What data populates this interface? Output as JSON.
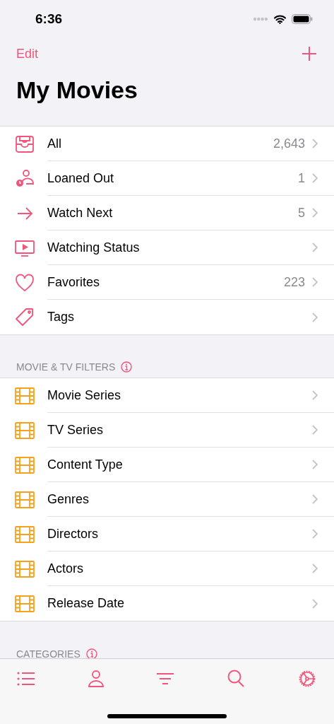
{
  "status_bar": {
    "time": "6:36"
  },
  "nav": {
    "edit": "Edit",
    "title": "My Movies"
  },
  "main_list": [
    {
      "label": "All",
      "count": "2,643"
    },
    {
      "label": "Loaned Out",
      "count": "1"
    },
    {
      "label": "Watch Next",
      "count": "5"
    },
    {
      "label": "Watching Status"
    },
    {
      "label": "Favorites",
      "count": "223"
    },
    {
      "label": "Tags"
    }
  ],
  "filters": {
    "header": "MOVIE & TV FILTERS",
    "items": [
      {
        "label": "Movie Series"
      },
      {
        "label": "TV Series"
      },
      {
        "label": "Content Type"
      },
      {
        "label": "Genres"
      },
      {
        "label": "Directors"
      },
      {
        "label": "Actors"
      },
      {
        "label": "Release Date"
      }
    ]
  },
  "categories": {
    "header": "CATEGORIES"
  }
}
